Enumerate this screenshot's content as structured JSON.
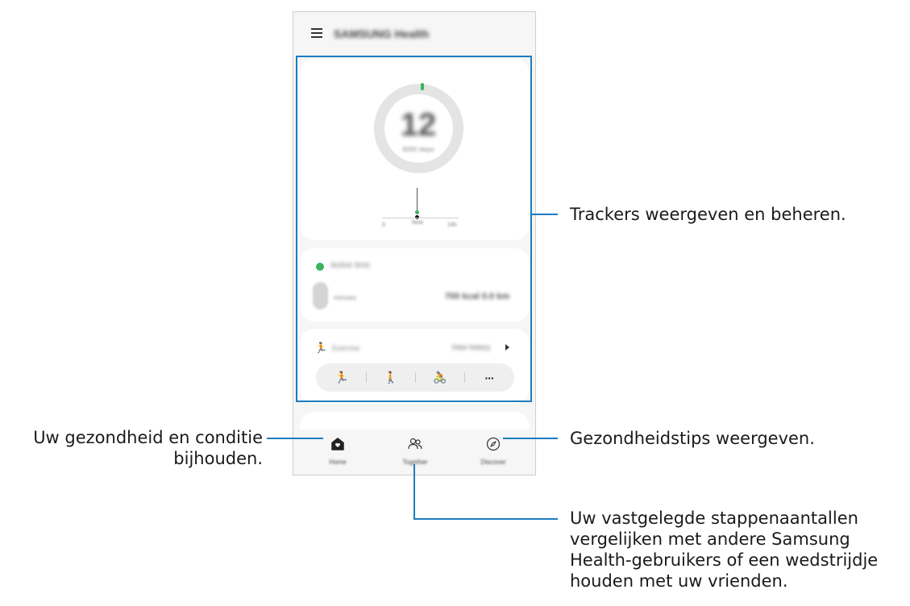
{
  "app": {
    "title": "SAMSUNG Health"
  },
  "steps_card": {
    "value": "12",
    "caption": "6000 steps",
    "tick_start": "0",
    "tick_now": "Now",
    "tick_end": "24h"
  },
  "active_card": {
    "title": "Active time",
    "value_label": "minutes",
    "stats": "700 kcal 0.0 km"
  },
  "exercise_card": {
    "title": "Exercise",
    "link": "View history",
    "buttons": [
      {
        "name": "running",
        "glyph": "🏃"
      },
      {
        "name": "walking",
        "glyph": "🚶"
      },
      {
        "name": "cycling",
        "glyph": "🚴"
      },
      {
        "name": "more",
        "glyph": "···"
      }
    ]
  },
  "bottom_nav": {
    "home": "Home",
    "together": "Together",
    "discover": "Discover"
  },
  "colors": {
    "accent_green": "#3fb35e",
    "callout_blue": "#1d7cbf"
  },
  "callouts": {
    "trackers": "Trackers weergeven en beheren.",
    "home_line1": "Uw gezondheid en conditie",
    "home_line2": "bijhouden.",
    "discover": "Gezondheidstips weergeven.",
    "together_line1": "Uw vastgelegde stappenaantallen",
    "together_line2": "vergelijken met andere Samsung",
    "together_line3": "Health-gebruikers of een wedstrijdje",
    "together_line4": "houden met uw vrienden."
  }
}
